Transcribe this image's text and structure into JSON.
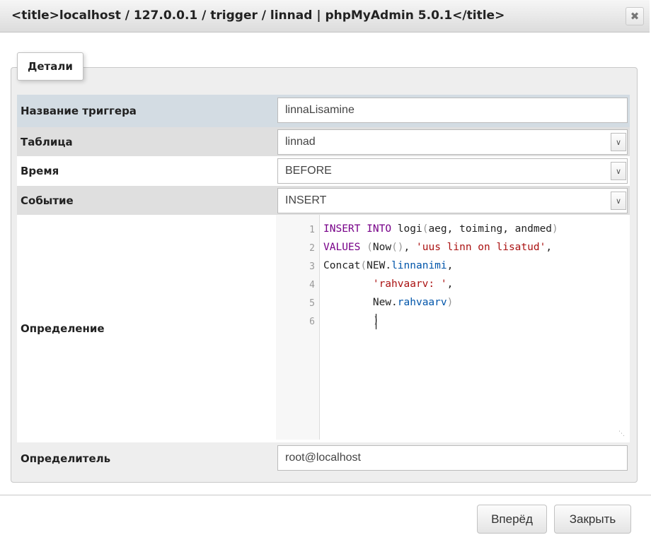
{
  "window": {
    "title": "<title>localhost / 127.0.0.1 / trigger / linnad | phpMyAdmin 5.0.1</title>",
    "close_glyph": "✖"
  },
  "tab": {
    "label": "Детали"
  },
  "form": {
    "trigger_name": {
      "label": "Название триггера",
      "value": "linnaLisamine"
    },
    "table": {
      "label": "Таблица",
      "value": "linnad"
    },
    "time": {
      "label": "Время",
      "value": "BEFORE"
    },
    "event": {
      "label": "Событие",
      "value": "INSERT"
    },
    "definition": {
      "label": "Определение",
      "line_numbers": [
        "1",
        "2",
        "3",
        "4",
        "5",
        "6"
      ],
      "lines": [
        {
          "kw1": "INSERT",
          "sp1": " ",
          "kw2": "INTO",
          "rest": " logi",
          "b1": "(",
          "args": "aeg, toiming, andmed",
          "b2": ")"
        },
        {
          "kw": "VALUES",
          "sp": " ",
          "b1": "(",
          "fn": "Now",
          "b2": "()",
          "comma": ", ",
          "str": "'uus linn on lisatud'",
          "tail": ","
        },
        {
          "fn": "Concat",
          "b1": "(",
          "obj": "NEW",
          "dot": ".",
          "prop": "linnanimi",
          "tail": ","
        },
        {
          "indent": "        ",
          "str": "'rahvaarv: '",
          "tail": ","
        },
        {
          "indent": "        ",
          "obj": "New",
          "dot": ".",
          "prop": "rahvaarv",
          "b1": ")"
        },
        {
          "indent": "        ",
          "b1": ")"
        }
      ]
    },
    "definer": {
      "label": "Определитель",
      "value": "root@localhost"
    }
  },
  "buttons": {
    "forward": "Вперёд",
    "close": "Закрыть"
  },
  "icons": {
    "select_arrow": "chevron-down-icon",
    "resize": "resize-grip-icon"
  }
}
